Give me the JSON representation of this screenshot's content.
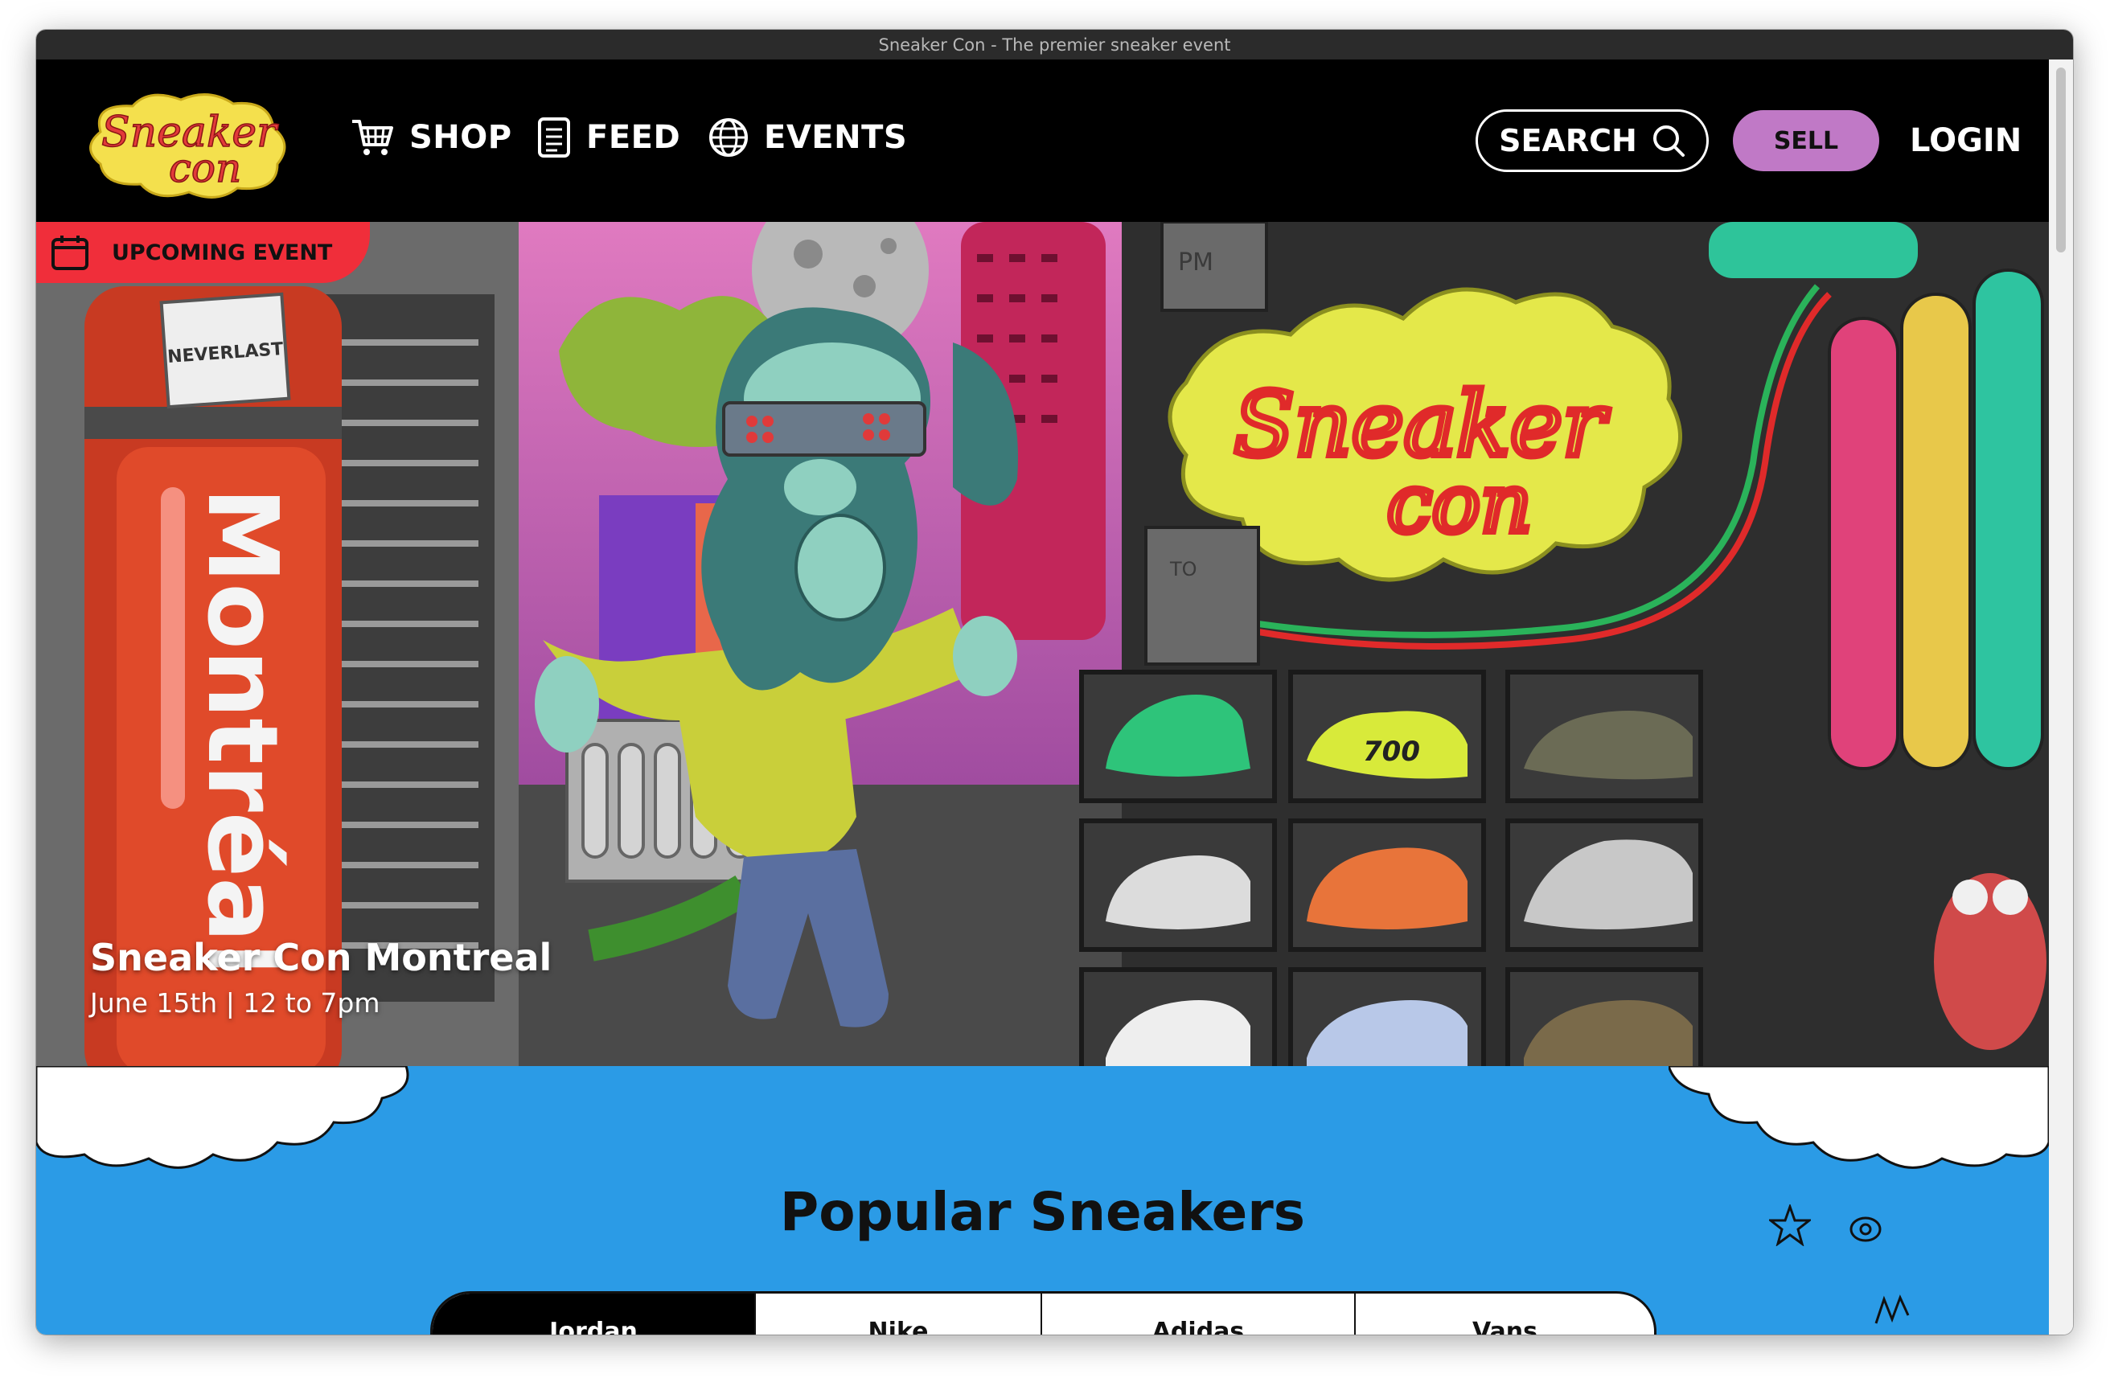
{
  "window": {
    "title": "Sneaker Con - The premier sneaker event"
  },
  "brand": {
    "logo_text": "Sneaker Con",
    "logo_line1": "Sneaker",
    "logo_line2": "con"
  },
  "nav": {
    "items": [
      {
        "label": "SHOP",
        "icon": "cart-icon"
      },
      {
        "label": "FEED",
        "icon": "document-icon"
      },
      {
        "label": "EVENTS",
        "icon": "globe-icon"
      }
    ],
    "search_label": "SEARCH",
    "sell_label": "SELL",
    "login_label": "LOGIN"
  },
  "hero": {
    "badge_label": "UPCOMING EVENT",
    "event_title": "Sneaker Con Montreal",
    "event_date": "June 15th | 12 to 7pm",
    "banner_city": "Montréal",
    "bag_brand": "NEVERLAST",
    "sign_line1": "Sneaker",
    "sign_line2": "con",
    "box_text": "PM",
    "box_text2": "TO",
    "shoe_text": "700"
  },
  "popular": {
    "title": "Popular Sneakers",
    "tabs": [
      "Jordan",
      "Nike",
      "Adidas",
      "Vans"
    ],
    "active_tab": "Jordan"
  },
  "colors": {
    "nav_bg": "#000000",
    "sell": "#c079c6",
    "badge": "#f02e3a",
    "section_bg": "#2b9be6",
    "logo_yellow": "#f4e04d",
    "logo_red": "#e23a3a"
  }
}
